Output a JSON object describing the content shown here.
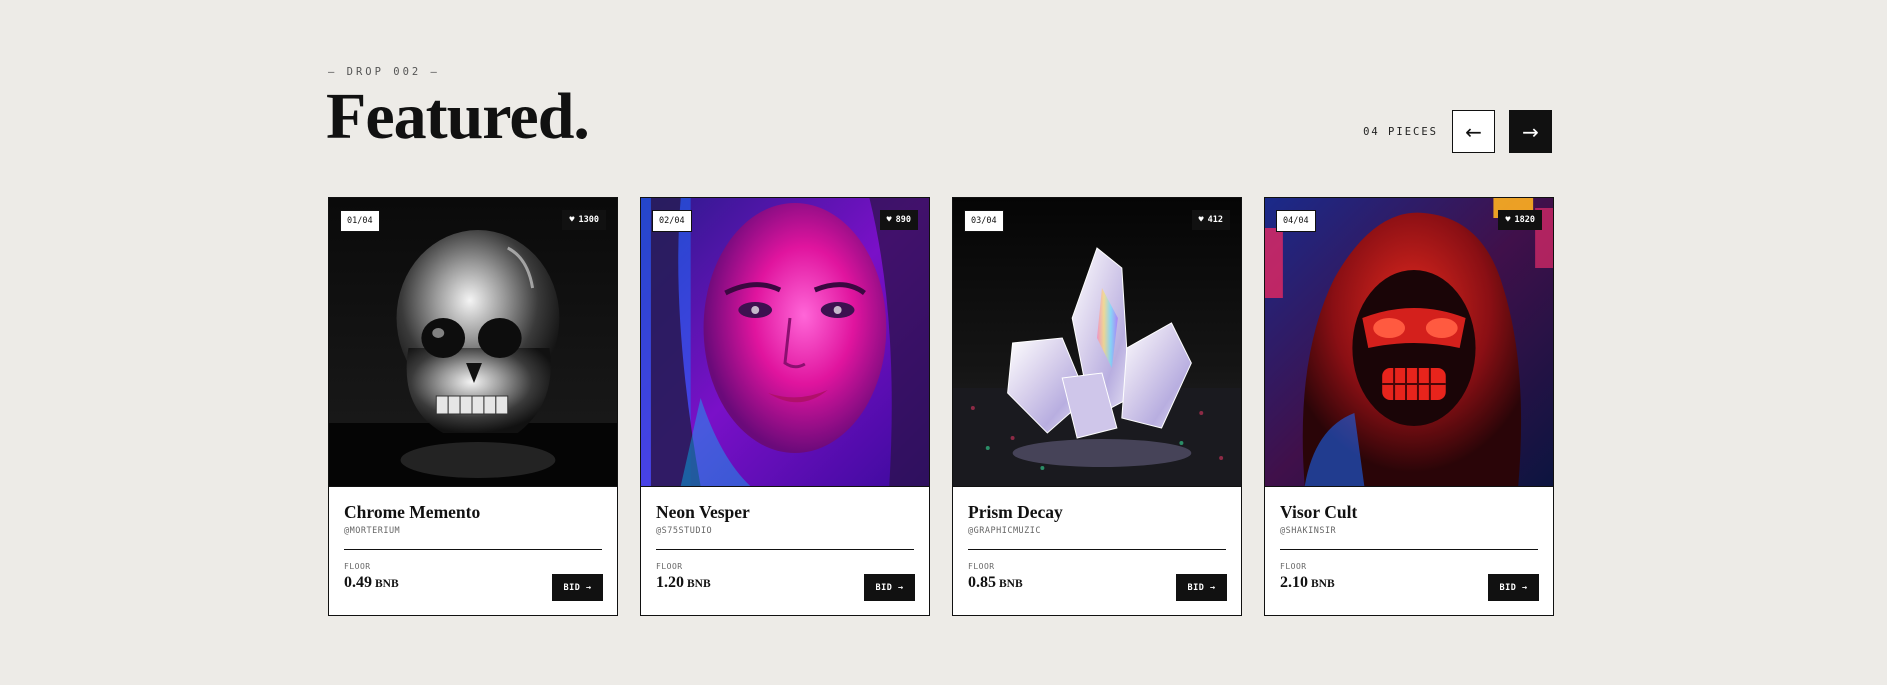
{
  "header": {
    "eyebrow": "— DROP 002 —",
    "title": "Featured.",
    "count": "04 PIECES",
    "prev_icon": "←",
    "next_icon": "→"
  },
  "cards": [
    {
      "index": "01/04",
      "likes": "1300",
      "name": "Chrome Memento",
      "handle": "@MORTERIUM",
      "floor_label": "FLOOR",
      "price": "0.49",
      "currency": "BNB",
      "bid_label": "BID →",
      "art": "chrome-skull-image"
    },
    {
      "index": "02/04",
      "likes": "890",
      "name": "Neon Vesper",
      "handle": "@S75STUDIO",
      "floor_label": "FLOOR",
      "price": "1.20",
      "currency": "BNB",
      "bid_label": "BID →",
      "art": "neon-portrait-image"
    },
    {
      "index": "03/04",
      "likes": "412",
      "name": "Prism Decay",
      "handle": "@GRAPHICMUZIC",
      "floor_label": "FLOOR",
      "price": "0.85",
      "currency": "BNB",
      "bid_label": "BID →",
      "art": "crystal-image"
    },
    {
      "index": "04/04",
      "likes": "1820",
      "name": "Visor Cult",
      "handle": "@SHAKINSIR",
      "floor_label": "FLOOR",
      "price": "2.10",
      "currency": "BNB",
      "bid_label": "BID →",
      "art": "masked-hood-image"
    }
  ],
  "heart_icon": "♥",
  "colors": {
    "background": "#edebe7",
    "ink": "#111111",
    "card": "#ffffff"
  }
}
